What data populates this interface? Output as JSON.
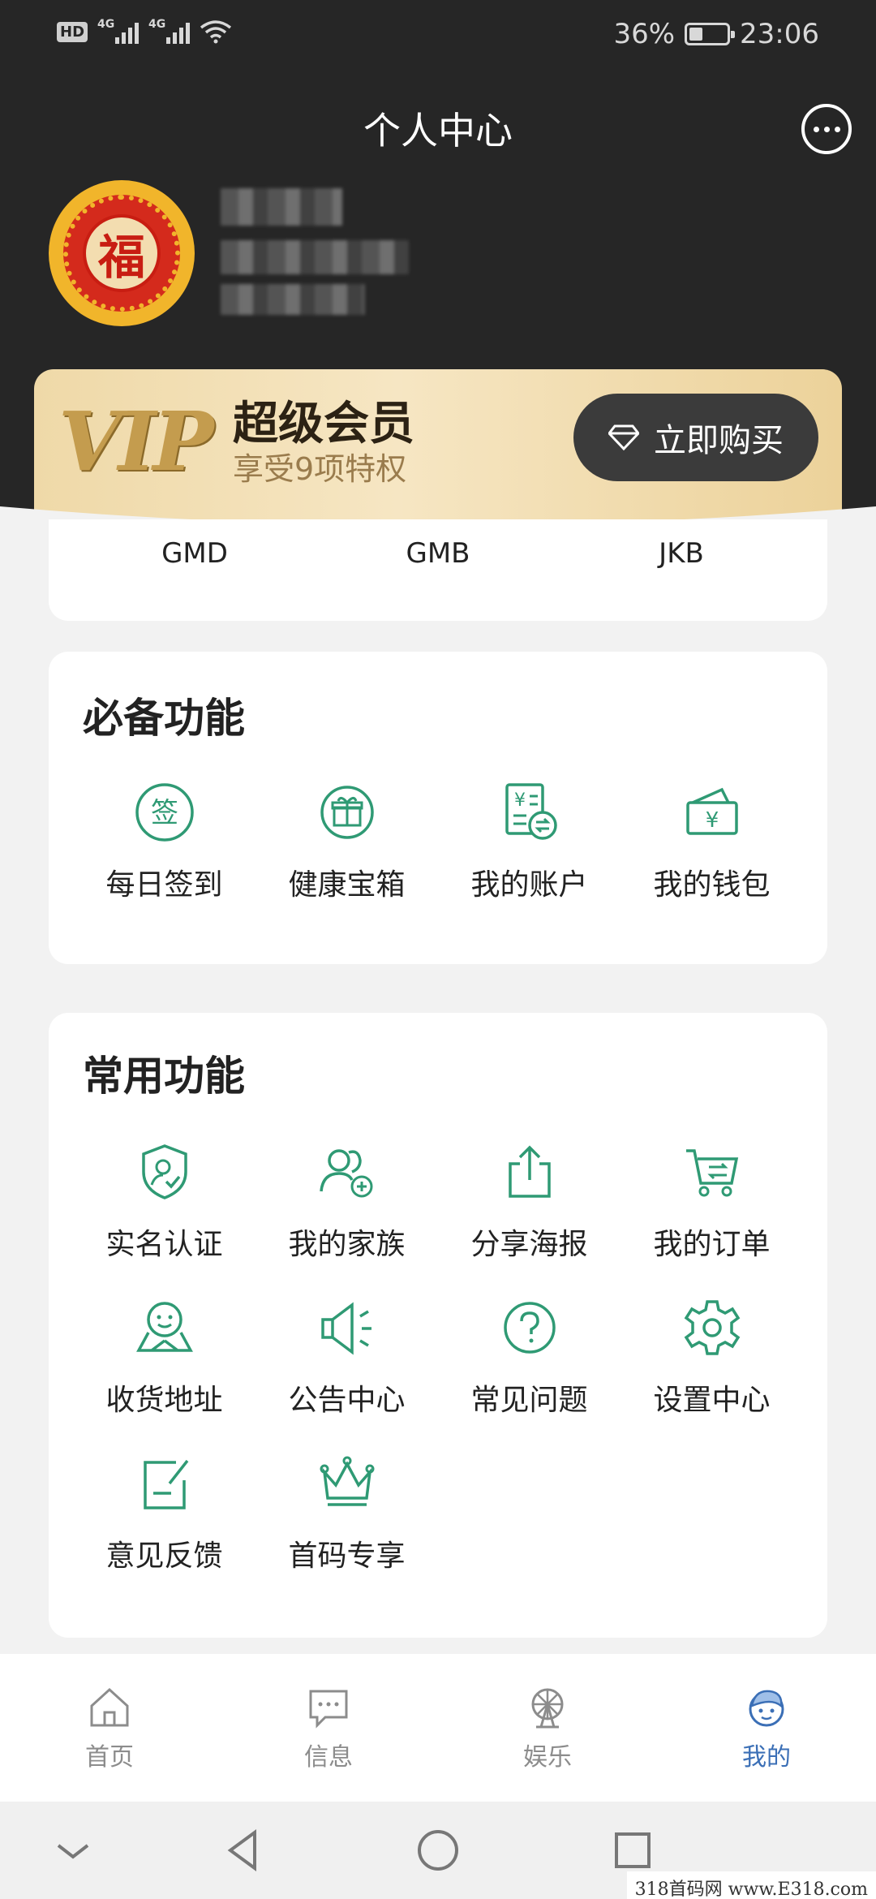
{
  "status_bar": {
    "network_badge": "HD",
    "signal_1": "4G",
    "signal_2": "4G",
    "battery_percent": "36%",
    "battery_level": 0.36,
    "time": "23:06"
  },
  "header": {
    "title": "个人中心",
    "more_icon": "more-dots-icon"
  },
  "profile": {
    "avatar_text": "福"
  },
  "vip": {
    "logo": "VIP",
    "title": "超级会员",
    "subtitle": "享受9项特权",
    "buy_label": "立即购买"
  },
  "coins": [
    "GMD",
    "GMB",
    "JKB"
  ],
  "essential": {
    "title": "必备功能",
    "items": [
      {
        "label": "每日签到",
        "icon": "checkin-icon"
      },
      {
        "label": "健康宝箱",
        "icon": "gift-box-icon"
      },
      {
        "label": "我的账户",
        "icon": "account-icon"
      },
      {
        "label": "我的钱包",
        "icon": "wallet-icon"
      }
    ]
  },
  "common": {
    "title": "常用功能",
    "items": [
      {
        "label": "实名认证",
        "icon": "verify-shield-icon"
      },
      {
        "label": "我的家族",
        "icon": "family-icon"
      },
      {
        "label": "分享海报",
        "icon": "share-icon"
      },
      {
        "label": "我的订单",
        "icon": "cart-icon"
      },
      {
        "label": "收货地址",
        "icon": "address-icon"
      },
      {
        "label": "公告中心",
        "icon": "megaphone-icon"
      },
      {
        "label": "常见问题",
        "icon": "question-icon"
      },
      {
        "label": "设置中心",
        "icon": "settings-gear-icon"
      },
      {
        "label": "意见反馈",
        "icon": "feedback-icon"
      },
      {
        "label": "首码专享",
        "icon": "crown-icon"
      }
    ]
  },
  "bottom_nav": [
    {
      "label": "首页",
      "icon": "home-icon"
    },
    {
      "label": "信息",
      "icon": "message-icon"
    },
    {
      "label": "娱乐",
      "icon": "ferris-wheel-icon"
    },
    {
      "label": "我的",
      "icon": "profile-face-icon",
      "active": true
    }
  ],
  "colors": {
    "accent_green": "#2f9a74",
    "active_tab": "#3b6fb6",
    "header_bg": "#262626",
    "gold": "#efd9a8"
  },
  "watermark": "318首码网 www.E318.com"
}
